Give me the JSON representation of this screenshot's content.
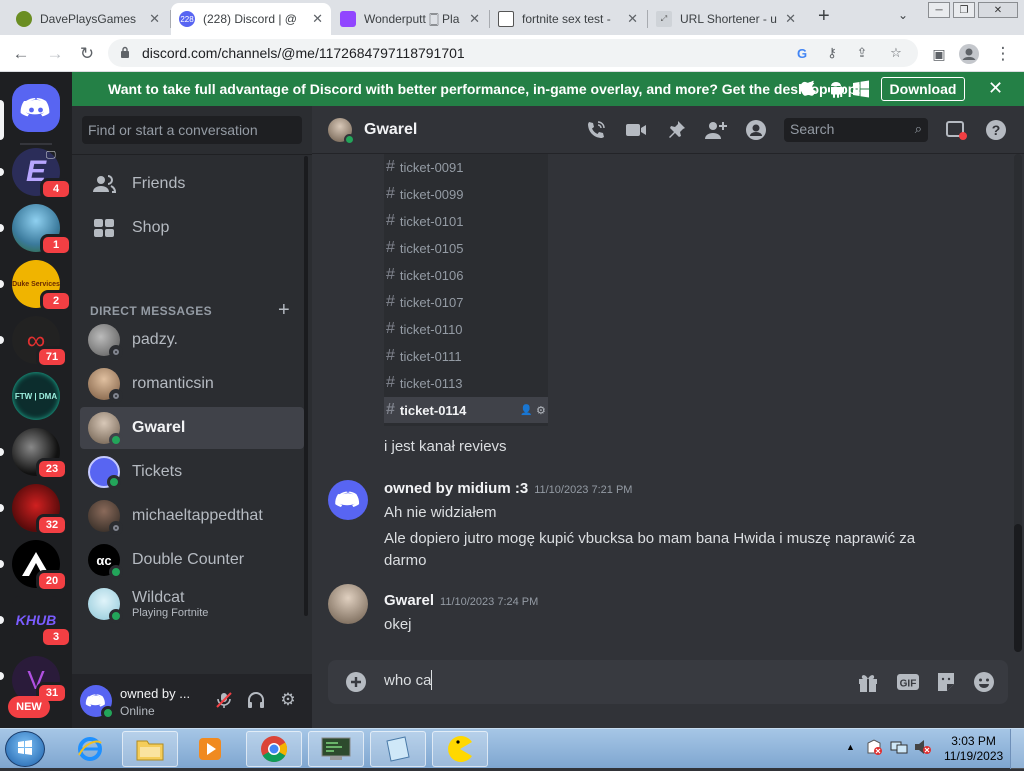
{
  "browser": {
    "tabs": [
      {
        "title": "DavePlaysGames",
        "favicon": "sphere-icon",
        "color": "#6b8e23",
        "active": false
      },
      {
        "title": "(228) Discord | @",
        "favicon": "discord-icon",
        "color": "#5865f2",
        "active": true
      },
      {
        "title": "Wonderputt 🀆 Pla",
        "favicon": "twitch-icon",
        "color": "#9146ff",
        "active": false
      },
      {
        "title": "fortnite sex test -",
        "favicon": "page-icon",
        "color": "#555555",
        "active": false
      },
      {
        "title": "URL Shortener - u",
        "favicon": "link-icon",
        "color": "#777777",
        "active": false
      }
    ],
    "url": "discord.com/channels/@me/1172684797118791701"
  },
  "banner": {
    "message": "Want to take full advantage of Discord with better performance, in-game overlay, and more? Get the desktop app!",
    "download_label": "Download",
    "color": "#248046"
  },
  "servers": [
    {
      "name": "E",
      "badge": "4",
      "color": "#2b2d59"
    },
    {
      "name": "",
      "badge": "1",
      "color": "#3b7a9c"
    },
    {
      "name": "",
      "badge": "2",
      "color": "#f0b400"
    },
    {
      "name": "",
      "badge": "71",
      "color": "#222222"
    },
    {
      "name": "FTW | DMA",
      "badge": "",
      "color": "#0c2d2d"
    },
    {
      "name": "",
      "badge": "23",
      "color": "#111111"
    },
    {
      "name": "",
      "badge": "32",
      "color": "#5a0b0b"
    },
    {
      "name": "",
      "badge": "20",
      "color": "#000000"
    },
    {
      "name": "KHUB",
      "badge": "3",
      "color": "#1e1f22"
    },
    {
      "name": "",
      "badge": "31",
      "color": "#2a1b3a"
    }
  ],
  "new_badge": "NEW",
  "sidebar": {
    "search_placeholder": "Find or start a conversation",
    "friends_label": "Friends",
    "shop_label": "Shop",
    "dm_header": "DIRECT MESSAGES",
    "dms": [
      {
        "name": "padzy.",
        "status": "offline",
        "sub": "",
        "color": "#6d6d6d"
      },
      {
        "name": "romanticsin",
        "status": "offline",
        "sub": "",
        "color": "#a0826d"
      },
      {
        "name": "Gwarel",
        "status": "online",
        "sub": "",
        "color": "#8a7b6b",
        "selected": true
      },
      {
        "name": "Tickets",
        "status": "online",
        "sub": "",
        "color": "#5865f2"
      },
      {
        "name": "michaeltappedthat",
        "status": "offline",
        "sub": "",
        "color": "#3a3530"
      },
      {
        "name": "Double Counter",
        "status": "online",
        "sub": "",
        "color": "#000000"
      },
      {
        "name": "Wildcat",
        "status": "online",
        "sub": "Playing Fortnite",
        "color": "#8fc7d8"
      }
    ]
  },
  "user_panel": {
    "name": "owned by ...",
    "status": "Online"
  },
  "chat": {
    "header_name": "Gwarel",
    "search_placeholder": "Search",
    "tickets": [
      {
        "name": "ticket-0091"
      },
      {
        "name": "ticket-0099"
      },
      {
        "name": "ticket-0101"
      },
      {
        "name": "ticket-0105"
      },
      {
        "name": "ticket-0106"
      },
      {
        "name": "ticket-0107"
      },
      {
        "name": "ticket-0110"
      },
      {
        "name": "ticket-0111"
      },
      {
        "name": "ticket-0113"
      },
      {
        "name": "ticket-0114",
        "selected": true
      }
    ],
    "messages": [
      {
        "author": "",
        "time": "",
        "lines": [
          "i jest kanał revievs"
        ]
      },
      {
        "author": "owned by midium :3",
        "time": "11/10/2023 7:21 PM",
        "lines": [
          "Ah nie widziałem",
          "Ale dopiero jutro mogę kupić vbucksa bo mam bana Hwida i muszę naprawić za",
          "darmo"
        ]
      },
      {
        "author": "Gwarel",
        "time": "11/10/2023 7:24 PM",
        "lines": [
          "okej"
        ]
      }
    ],
    "composer_text": "who ca"
  },
  "taskbar": {
    "time": "3:03 PM",
    "date": "11/19/2023"
  }
}
